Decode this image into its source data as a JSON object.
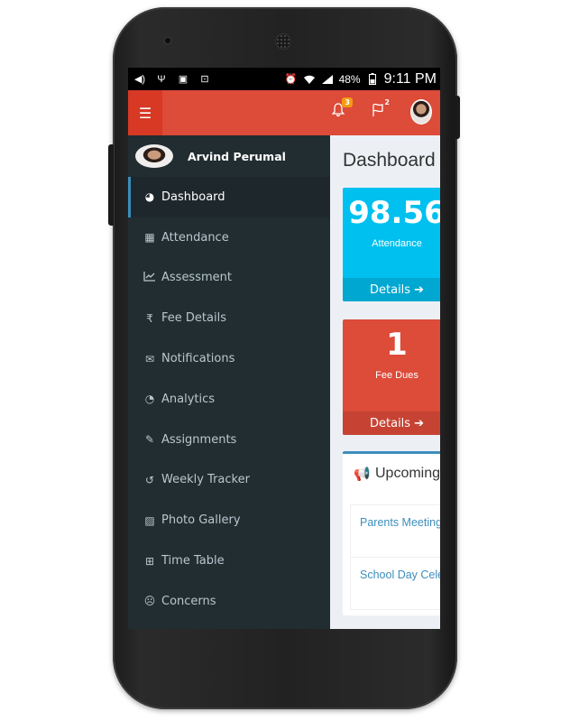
{
  "status_bar": {
    "battery": "48%",
    "time": "9:11 PM"
  },
  "header": {
    "menu_icon": "hamburger-icon",
    "notification_count": "3",
    "flag_count": "2"
  },
  "sidebar": {
    "user_name": "Arvind Perumal",
    "items": [
      {
        "label": "Dashboard",
        "icon": "dashboard-icon"
      },
      {
        "label": "Attendance",
        "icon": "calendar-icon"
      },
      {
        "label": "Assessment",
        "icon": "line-chart-icon"
      },
      {
        "label": "Fee Details",
        "icon": "rupee-icon"
      },
      {
        "label": "Notifications",
        "icon": "envelope-icon"
      },
      {
        "label": "Analytics",
        "icon": "pie-chart-icon"
      },
      {
        "label": "Assignments",
        "icon": "edit-icon"
      },
      {
        "label": "Weekly Tracker",
        "icon": "history-icon"
      },
      {
        "label": "Photo Gallery",
        "icon": "picture-icon"
      },
      {
        "label": "Time Table",
        "icon": "table-icon"
      },
      {
        "label": "Concerns",
        "icon": "frown-icon"
      }
    ]
  },
  "main": {
    "title": "Dashboard",
    "attendance_box": {
      "value": "98.56",
      "label": "Attendance",
      "footer": "Details",
      "color": "#00c0ef"
    },
    "fee_box": {
      "value": "1",
      "label": "Fee Dues",
      "footer": "Details",
      "color": "#dd4b39"
    },
    "upcoming": {
      "title": "Upcoming",
      "items": [
        {
          "label": "Parents Meeting"
        },
        {
          "label": "School Day Cele"
        }
      ]
    }
  },
  "colors": {
    "header": "#dd4b39",
    "sidebar": "#222d32",
    "accent": "#3c8dbc"
  }
}
